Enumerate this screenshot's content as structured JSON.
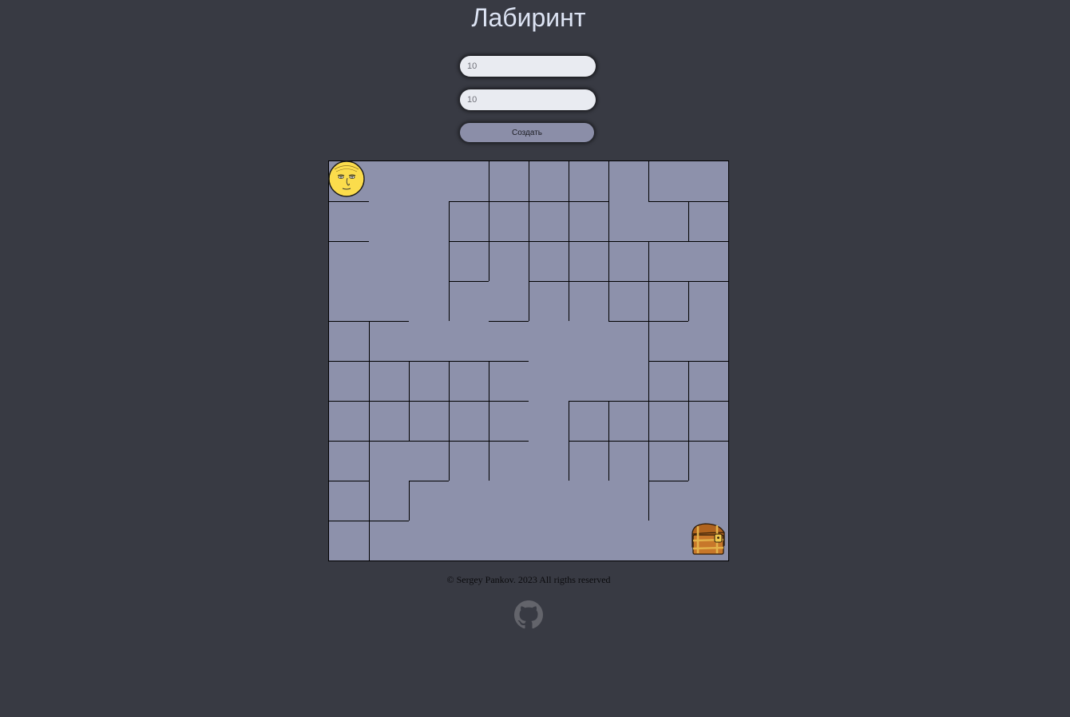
{
  "page": {
    "title": "Лабиринт"
  },
  "controls": {
    "rows_value": "10",
    "cols_value": "10",
    "create_label": "Создать"
  },
  "maze": {
    "rows": 10,
    "cols": 10,
    "player": {
      "row": 0,
      "col": 0,
      "icon": "face-icon"
    },
    "goal": {
      "row": 9,
      "col": 9,
      "icon": "treasure-chest-icon"
    },
    "horizontal_walls": [
      [],
      [
        0,
        3,
        4,
        5,
        6,
        8,
        9
      ],
      [
        0,
        3,
        4,
        5,
        6,
        7,
        8,
        9
      ],
      [
        3,
        5,
        6,
        7,
        8,
        9
      ],
      [
        0,
        1,
        4,
        7,
        8
      ],
      [
        0,
        1,
        2,
        3,
        4,
        8,
        9
      ],
      [
        0,
        1,
        2,
        3,
        4,
        6,
        7,
        8,
        9
      ],
      [
        0,
        1,
        2,
        3,
        4,
        6,
        7,
        8,
        9
      ],
      [
        0,
        2,
        8
      ],
      [
        0,
        1
      ]
    ],
    "vertical_walls": [
      [
        4,
        5,
        6,
        7,
        8
      ],
      [
        3,
        4,
        5,
        6,
        7,
        9
      ],
      [
        3,
        4,
        5,
        6,
        7,
        8
      ],
      [
        3,
        5,
        6,
        7,
        8,
        9
      ],
      [
        1,
        8
      ],
      [
        1,
        2,
        3,
        4,
        8,
        9
      ],
      [
        1,
        2,
        3,
        4,
        6,
        7,
        8,
        9
      ],
      [
        1,
        3,
        4,
        6,
        7,
        8,
        9
      ],
      [
        1,
        2,
        8
      ],
      [
        1
      ]
    ],
    "colors": {
      "floor": "#8d91ab",
      "wall": "#000000",
      "player": "#fbdc4c",
      "chest": "#b0631e"
    }
  },
  "footer": {
    "copyright": "© Sergey Pankov. 2023 All rigths reserved",
    "github_icon": "github-icon"
  }
}
